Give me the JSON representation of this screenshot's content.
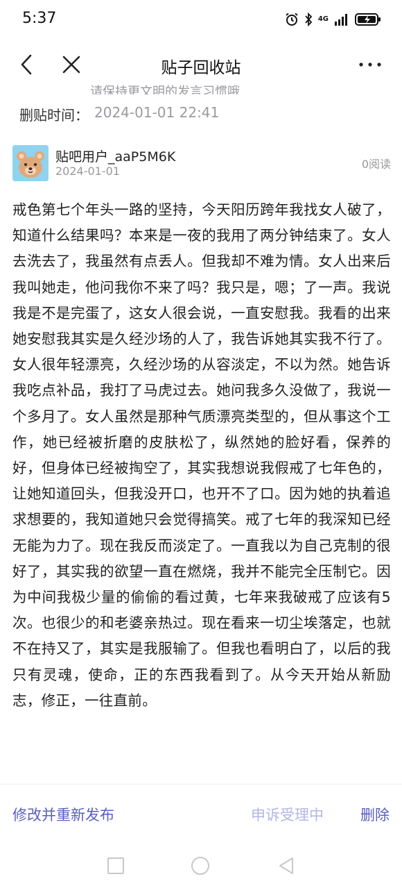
{
  "status_bar": {
    "time": "5:37",
    "icons": [
      "alarm-icon",
      "bluetooth-icon",
      "signal-4g-icon",
      "battery-icon"
    ],
    "network": "4G"
  },
  "nav": {
    "title": "贴子回收站",
    "back_icon": "back-arrow-icon",
    "close_icon": "close-icon",
    "more_icon": "more-icon"
  },
  "notice": {
    "cutoff_text": "请保持更文明的发言习惯哦"
  },
  "delete_time": {
    "label": "删贴时间：",
    "value": "2024-01-01 22:41"
  },
  "author": {
    "name": "贴吧用户_aaP5M6K",
    "date": "2024-01-01",
    "read_count": "0阅读"
  },
  "post": {
    "body": "戒色第七个年头一路的坚持，今天阳历跨年我找女人破了，知道什么结果吗？本来是一夜的我用了两分钟结束了。女人去洗去了，我虽然有点丢人。但我却不难为情。女人出来后我叫她走，他问我你不来了吗？我只是，嗯；了一声。我说我是不是完蛋了，这女人很会说，一直安慰我。我看的出来她安慰我其实是久经沙场的人了，我告诉她其实我不行了。女人很年轻漂亮，久经沙场的从容淡定，不以为然。她告诉我吃点补品，我打了马虎过去。她问我多久没做了，我说一个多月了。女人虽然是那种气质漂亮类型的，但从事这个工作，她已经被折磨的皮肤松了，纵然她的脸好看，保养的好，但身体已经被掏空了，其实我想说我假戒了七年色的，让她知道回头，但我没开口，也开不了口。因为她的执着追求想要的，我知道她只会觉得搞笑。戒了七年的我深知已经无能为力了。现在我反而淡定了。一直我以为自己克制的很好了，其实我的欲望一直在燃烧，我并不能完全压制它。因为中间我极少量的偷偷的看过黄，七年来我破戒了应该有5次。也很少的和老婆亲热过。现在看来一切尘埃落定，也就不在持又了，其实是我服输了。但我也看明白了，以后的我只有灵魂，使命，正的东西我看到了。从今天开始从新励志，修正，一往直前。"
  },
  "actions": {
    "republish": "修改并重新发布",
    "appeal": "申诉受理中",
    "delete": "删除"
  },
  "colors": {
    "accent": "#5a5fbf",
    "accent_disabled": "#b4b6e3",
    "muted": "#9a9aa0"
  }
}
